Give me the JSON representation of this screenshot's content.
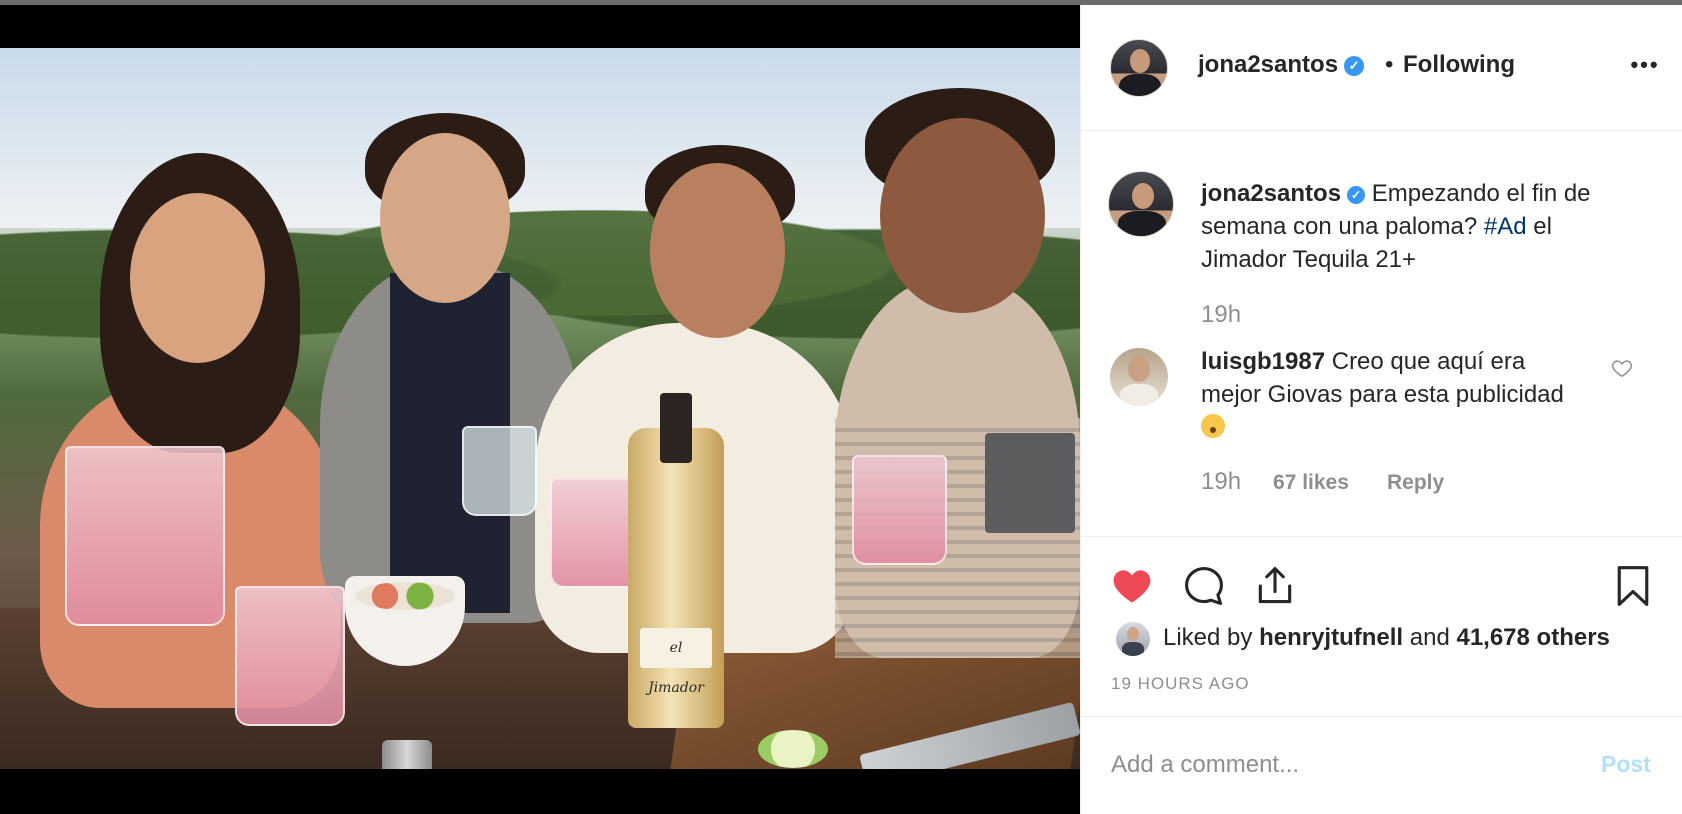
{
  "header": {
    "username": "jona2santos",
    "separator": "•",
    "follow_state": "Following",
    "more_label": "•••"
  },
  "media": {
    "bottle_label": "el Jimador"
  },
  "caption": {
    "username": "jona2santos",
    "text_before": " Empezando el fin de semana con una paloma? ",
    "hashtag": "#Ad",
    "text_after": " el Jimador Tequila 21+",
    "time": "19h"
  },
  "comment": {
    "username": "luisgb1987",
    "text": " Creo que aquí era mejor Giovas para esta publicidad ",
    "time": "19h",
    "likes": "67 likes",
    "reply_label": "Reply"
  },
  "actions": {
    "liked_prefix": "Liked by ",
    "liked_user": "henryjtufnell",
    "liked_mid": " and ",
    "liked_others": "41,678 others",
    "post_time": "19 HOURS AGO"
  },
  "comment_box": {
    "placeholder": "Add a comment...",
    "post_label": "Post"
  },
  "colors": {
    "verified": "#3897f0",
    "liked_heart": "#ed4956",
    "hashtag": "#003569",
    "post_disabled": "#b2dffc"
  },
  "icons": {
    "verified": "verified-badge-icon",
    "like": "heart-filled-icon",
    "comment": "comment-bubble-icon",
    "share": "share-upload-icon",
    "save": "bookmark-icon",
    "comment_like": "heart-outline-icon",
    "emoji": "shushing-face-emoji"
  }
}
